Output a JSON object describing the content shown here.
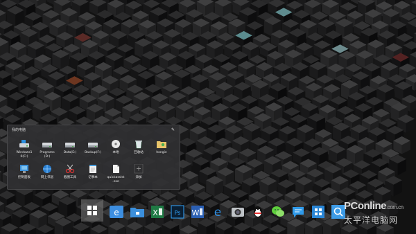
{
  "panel": {
    "title": "我的电脑",
    "items": [
      {
        "label": "Windows1\n0(C:)",
        "icon": "drive-windows-icon"
      },
      {
        "label": "Programs\n(D:)",
        "icon": "drive-icon"
      },
      {
        "label": "Data(E:)",
        "icon": "drive-icon"
      },
      {
        "label": "Backup(F:)",
        "icon": "drive-icon"
      },
      {
        "label": "本地",
        "icon": "cd-rom-icon"
      },
      {
        "label": "回收站",
        "icon": "recycle-bin-icon"
      },
      {
        "label": "hongie",
        "icon": "user-folder-icon"
      },
      {
        "label": "控制面板",
        "icon": "control-panel-icon"
      },
      {
        "label": "网上邻居",
        "icon": "network-icon"
      },
      {
        "label": "截图工具",
        "icon": "snipping-tool-icon"
      },
      {
        "label": "记事本",
        "icon": "notepad-icon"
      },
      {
        "label": "quickasslst\n.exe",
        "icon": "exe-file-icon"
      },
      {
        "label": "添加",
        "icon": "add-icon"
      }
    ]
  },
  "taskbar": {
    "items": [
      "start-button",
      "ie-icon",
      "folder-icon",
      "excel-icon",
      "photoshop-icon",
      "word-icon",
      "edge-icon",
      "camera-icon",
      "qq-icon",
      "wechat-icon",
      "messages-icon",
      "app-store-icon",
      "search-icon"
    ]
  },
  "watermark": {
    "brand": "PConline",
    "domain": ".com.cn",
    "cn": "太平洋电脑网"
  },
  "colors": {
    "accent": "#2b8fe0",
    "panel": "#303032"
  }
}
